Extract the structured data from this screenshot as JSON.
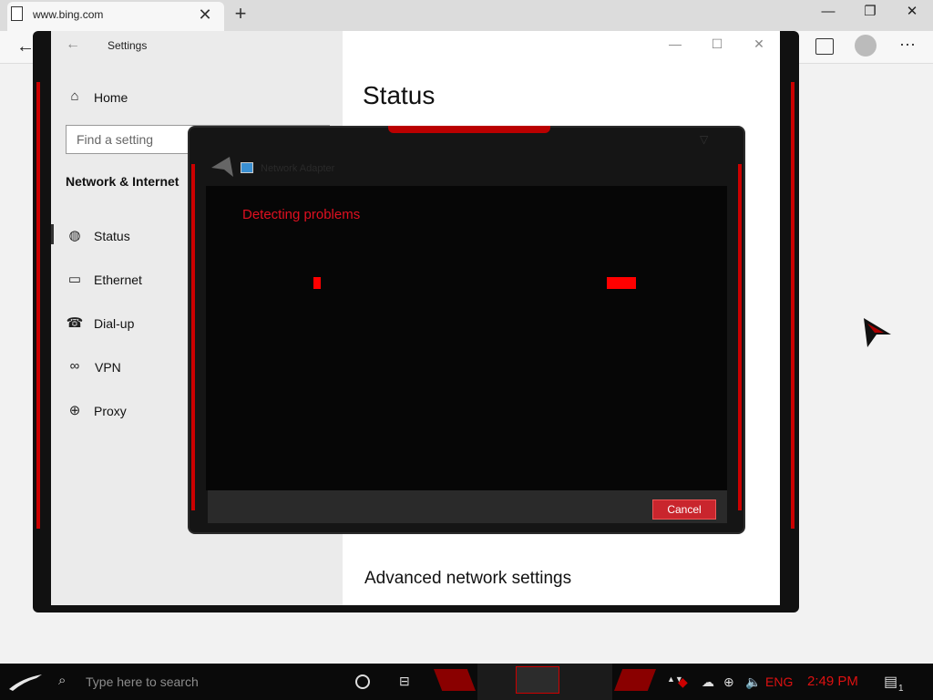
{
  "browser": {
    "tab_title": "www.bing.com",
    "tab_close": "✕",
    "new_tab": "+",
    "minimize": "—",
    "restore": "❐",
    "close": "✕",
    "back": "←",
    "more": "···"
  },
  "settings": {
    "window_title": "Settings",
    "back": "←",
    "home_label": "Home",
    "search_placeholder": "Find a setting",
    "section_header": "Network & Internet",
    "nav_items": [
      {
        "label": "Status",
        "icon": "globe-icon"
      },
      {
        "label": "Ethernet",
        "icon": "ethernet-icon"
      },
      {
        "label": "Dial-up",
        "icon": "dialup-icon"
      },
      {
        "label": "VPN",
        "icon": "vpn-icon"
      },
      {
        "label": "Proxy",
        "icon": "globe-icon"
      }
    ],
    "page_heading": "Status",
    "advanced_link": "Advanced network settings",
    "minimize": "—",
    "maximize": "☐",
    "close": "✕"
  },
  "dialog": {
    "title": "Network Adapter",
    "status_text": "Detecting problems",
    "cancel_label": "Cancel",
    "accent": "#e01020"
  },
  "taskbar": {
    "search_placeholder": "Type here to search",
    "language": "ENG",
    "time": "2:49 PM",
    "notification_count": "1"
  }
}
